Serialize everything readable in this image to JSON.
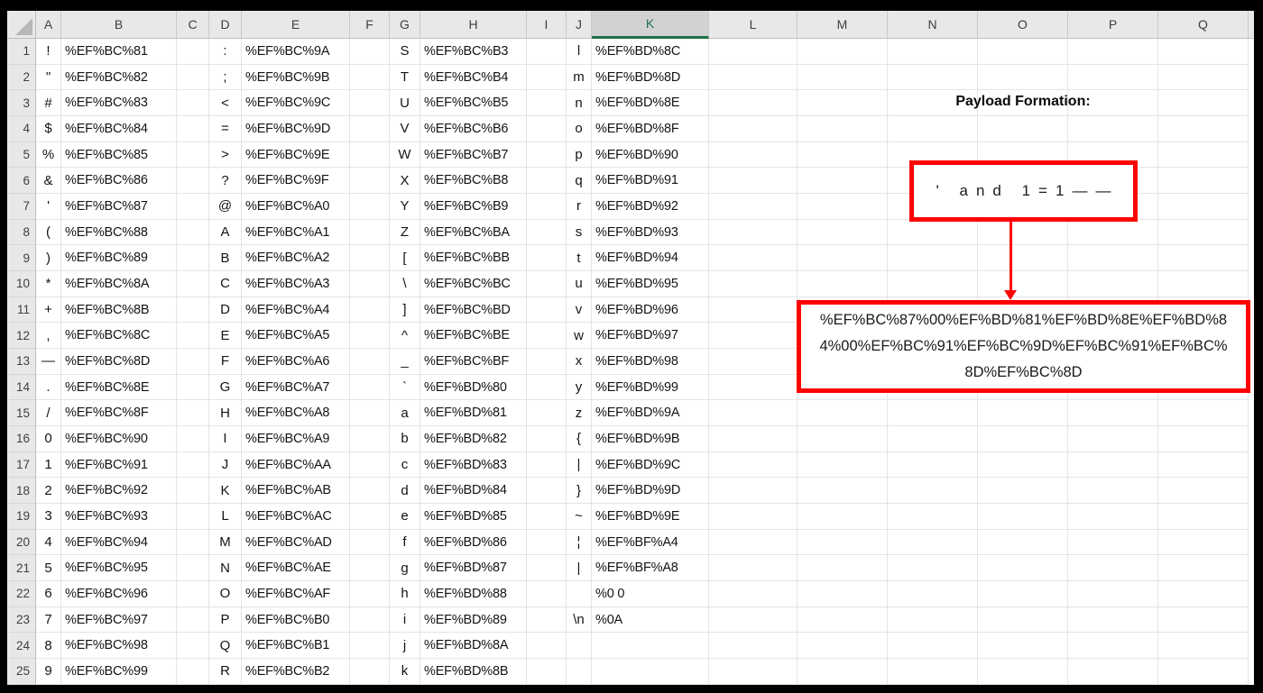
{
  "sheet": {
    "column_headers": [
      "A",
      "B",
      "C",
      "D",
      "E",
      "F",
      "G",
      "H",
      "I",
      "J",
      "K",
      "L",
      "M",
      "N",
      "O",
      "P",
      "Q"
    ],
    "selected_column": "K",
    "selection_green": "#1E7145",
    "rows": [
      {
        "n": "1",
        "A": "!",
        "B": "%EF%BC%81",
        "D": ":",
        "E": "%EF%BC%9A",
        "G": "S",
        "H": "%EF%BC%B3",
        "J": "l",
        "K": "%EF%BD%8C"
      },
      {
        "n": "2",
        "A": "\"",
        "B": "%EF%BC%82",
        "D": ";",
        "E": "%EF%BC%9B",
        "G": "T",
        "H": "%EF%BC%B4",
        "J": "m",
        "K": "%EF%BD%8D"
      },
      {
        "n": "3",
        "A": "#",
        "B": "%EF%BC%83",
        "D": "<",
        "E": "%EF%BC%9C",
        "G": "U",
        "H": "%EF%BC%B5",
        "J": "n",
        "K": "%EF%BD%8E"
      },
      {
        "n": "4",
        "A": "$",
        "B": "%EF%BC%84",
        "D": "=",
        "E": "%EF%BC%9D",
        "G": "V",
        "H": "%EF%BC%B6",
        "J": "o",
        "K": "%EF%BD%8F"
      },
      {
        "n": "5",
        "A": "%",
        "B": "%EF%BC%85",
        "D": ">",
        "E": "%EF%BC%9E",
        "G": "W",
        "H": "%EF%BC%B7",
        "J": "p",
        "K": "%EF%BD%90"
      },
      {
        "n": "6",
        "A": "&",
        "B": "%EF%BC%86",
        "D": "?",
        "E": "%EF%BC%9F",
        "G": "X",
        "H": "%EF%BC%B8",
        "J": "q",
        "K": "%EF%BD%91"
      },
      {
        "n": "7",
        "A": "'",
        "B": "%EF%BC%87",
        "D": "@",
        "E": "%EF%BC%A0",
        "G": "Y",
        "H": "%EF%BC%B9",
        "J": "r",
        "K": "%EF%BD%92"
      },
      {
        "n": "8",
        "A": "(",
        "B": "%EF%BC%88",
        "D": "A",
        "E": "%EF%BC%A1",
        "G": "Z",
        "H": "%EF%BC%BA",
        "J": "s",
        "K": "%EF%BD%93"
      },
      {
        "n": "9",
        "A": ")",
        "B": "%EF%BC%89",
        "D": "B",
        "E": "%EF%BC%A2",
        "G": "[",
        "H": "%EF%BC%BB",
        "J": "t",
        "K": "%EF%BD%94"
      },
      {
        "n": "10",
        "A": "*",
        "B": "%EF%BC%8A",
        "D": "C",
        "E": "%EF%BC%A3",
        "G": "\\",
        "H": "%EF%BC%BC",
        "J": "u",
        "K": "%EF%BD%95"
      },
      {
        "n": "11",
        "A": "+",
        "B": "%EF%BC%8B",
        "D": "D",
        "E": "%EF%BC%A4",
        "G": "]",
        "H": "%EF%BC%BD",
        "J": "v",
        "K": "%EF%BD%96"
      },
      {
        "n": "12",
        "A": ",",
        "B": "%EF%BC%8C",
        "D": "E",
        "E": "%EF%BC%A5",
        "G": "^",
        "H": "%EF%BC%BE",
        "J": "w",
        "K": "%EF%BD%97"
      },
      {
        "n": "13",
        "A": "—",
        "B": "%EF%BC%8D",
        "D": "F",
        "E": "%EF%BC%A6",
        "G": "_",
        "H": "%EF%BC%BF",
        "J": "x",
        "K": "%EF%BD%98"
      },
      {
        "n": "14",
        "A": ".",
        "B": "%EF%BC%8E",
        "D": "G",
        "E": "%EF%BC%A7",
        "G": "`",
        "H": "%EF%BD%80",
        "J": "y",
        "K": "%EF%BD%99"
      },
      {
        "n": "15",
        "A": "/",
        "B": "%EF%BC%8F",
        "D": "H",
        "E": "%EF%BC%A8",
        "G": "a",
        "H": "%EF%BD%81",
        "J": "z",
        "K": "%EF%BD%9A"
      },
      {
        "n": "16",
        "A": "0",
        "B": "%EF%BC%90",
        "D": "I",
        "E": "%EF%BC%A9",
        "G": "b",
        "H": "%EF%BD%82",
        "J": "{",
        "K": "%EF%BD%9B"
      },
      {
        "n": "17",
        "A": "1",
        "B": "%EF%BC%91",
        "D": "J",
        "E": "%EF%BC%AA",
        "G": "c",
        "H": "%EF%BD%83",
        "J": "|",
        "K": "%EF%BD%9C"
      },
      {
        "n": "18",
        "A": "2",
        "B": "%EF%BC%92",
        "D": "K",
        "E": "%EF%BC%AB",
        "G": "d",
        "H": "%EF%BD%84",
        "J": "}",
        "K": "%EF%BD%9D"
      },
      {
        "n": "19",
        "A": "3",
        "B": "%EF%BC%93",
        "D": "L",
        "E": "%EF%BC%AC",
        "G": "e",
        "H": "%EF%BD%85",
        "J": "~",
        "K": "%EF%BD%9E"
      },
      {
        "n": "20",
        "A": "4",
        "B": "%EF%BC%94",
        "D": "M",
        "E": "%EF%BC%AD",
        "G": "f",
        "H": "%EF%BD%86",
        "J": "¦",
        "K": "%EF%BF%A4"
      },
      {
        "n": "21",
        "A": "5",
        "B": "%EF%BC%95",
        "D": "N",
        "E": "%EF%BC%AE",
        "G": "g",
        "H": "%EF%BD%87",
        "J": "|",
        "K": "%EF%BF%A8"
      },
      {
        "n": "22",
        "A": "6",
        "B": "%EF%BC%96",
        "D": "O",
        "E": "%EF%BC%AF",
        "G": "h",
        "H": "%EF%BD%88",
        "J": "",
        "K": "%0 0"
      },
      {
        "n": "23",
        "A": "7",
        "B": "%EF%BC%97",
        "D": "P",
        "E": "%EF%BC%B0",
        "G": "i",
        "H": "%EF%BD%89",
        "J": "\\n",
        "K": "%0A"
      },
      {
        "n": "24",
        "A": "8",
        "B": "%EF%BC%98",
        "D": "Q",
        "E": "%EF%BC%B1",
        "G": "j",
        "H": "%EF%BD%8A",
        "J": "",
        "K": ""
      },
      {
        "n": "25",
        "A": "9",
        "B": "%EF%BC%99",
        "D": "R",
        "E": "%EF%BC%B2",
        "G": "k",
        "H": "%EF%BD%8B",
        "J": "",
        "K": ""
      }
    ]
  },
  "annotation": {
    "title": "Payload Formation:",
    "payload_text": "' and 1=1——",
    "encoded_payload_lines": {
      "0": "%EF%BC%87%00%EF%BD%81%EF%BD%8E%EF%BD%8",
      "1": "4%00%EF%BC%91%EF%BC%9D%EF%BC%91%EF%BC%",
      "2": "8D%EF%BC%8D"
    },
    "accent_red": "#FF0000"
  }
}
